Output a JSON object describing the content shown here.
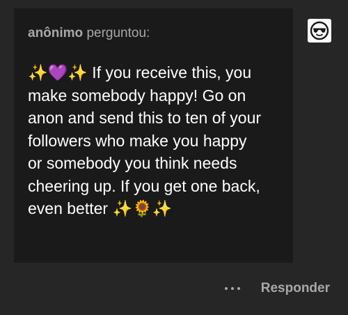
{
  "ask": {
    "asker_name": "anônimo",
    "asked_label": " perguntou:",
    "question": "✨💜✨ If you receive this, you\nmake somebody happy! Go on\nanon and send this to ten of your\nfollowers who make you happy\nor somebody you think needs\ncheering up. If you get one back,\neven better ✨🌻✨"
  },
  "avatar": {
    "icon": "anonymous-sunglasses-avatar-icon"
  },
  "footer": {
    "more_icon": "more-dots-icon",
    "reply_label": "Responder"
  },
  "colors": {
    "background": "#262626",
    "card": "#1a1a1a",
    "muted_text": "#a8a8a8",
    "text": "#ffffff"
  }
}
